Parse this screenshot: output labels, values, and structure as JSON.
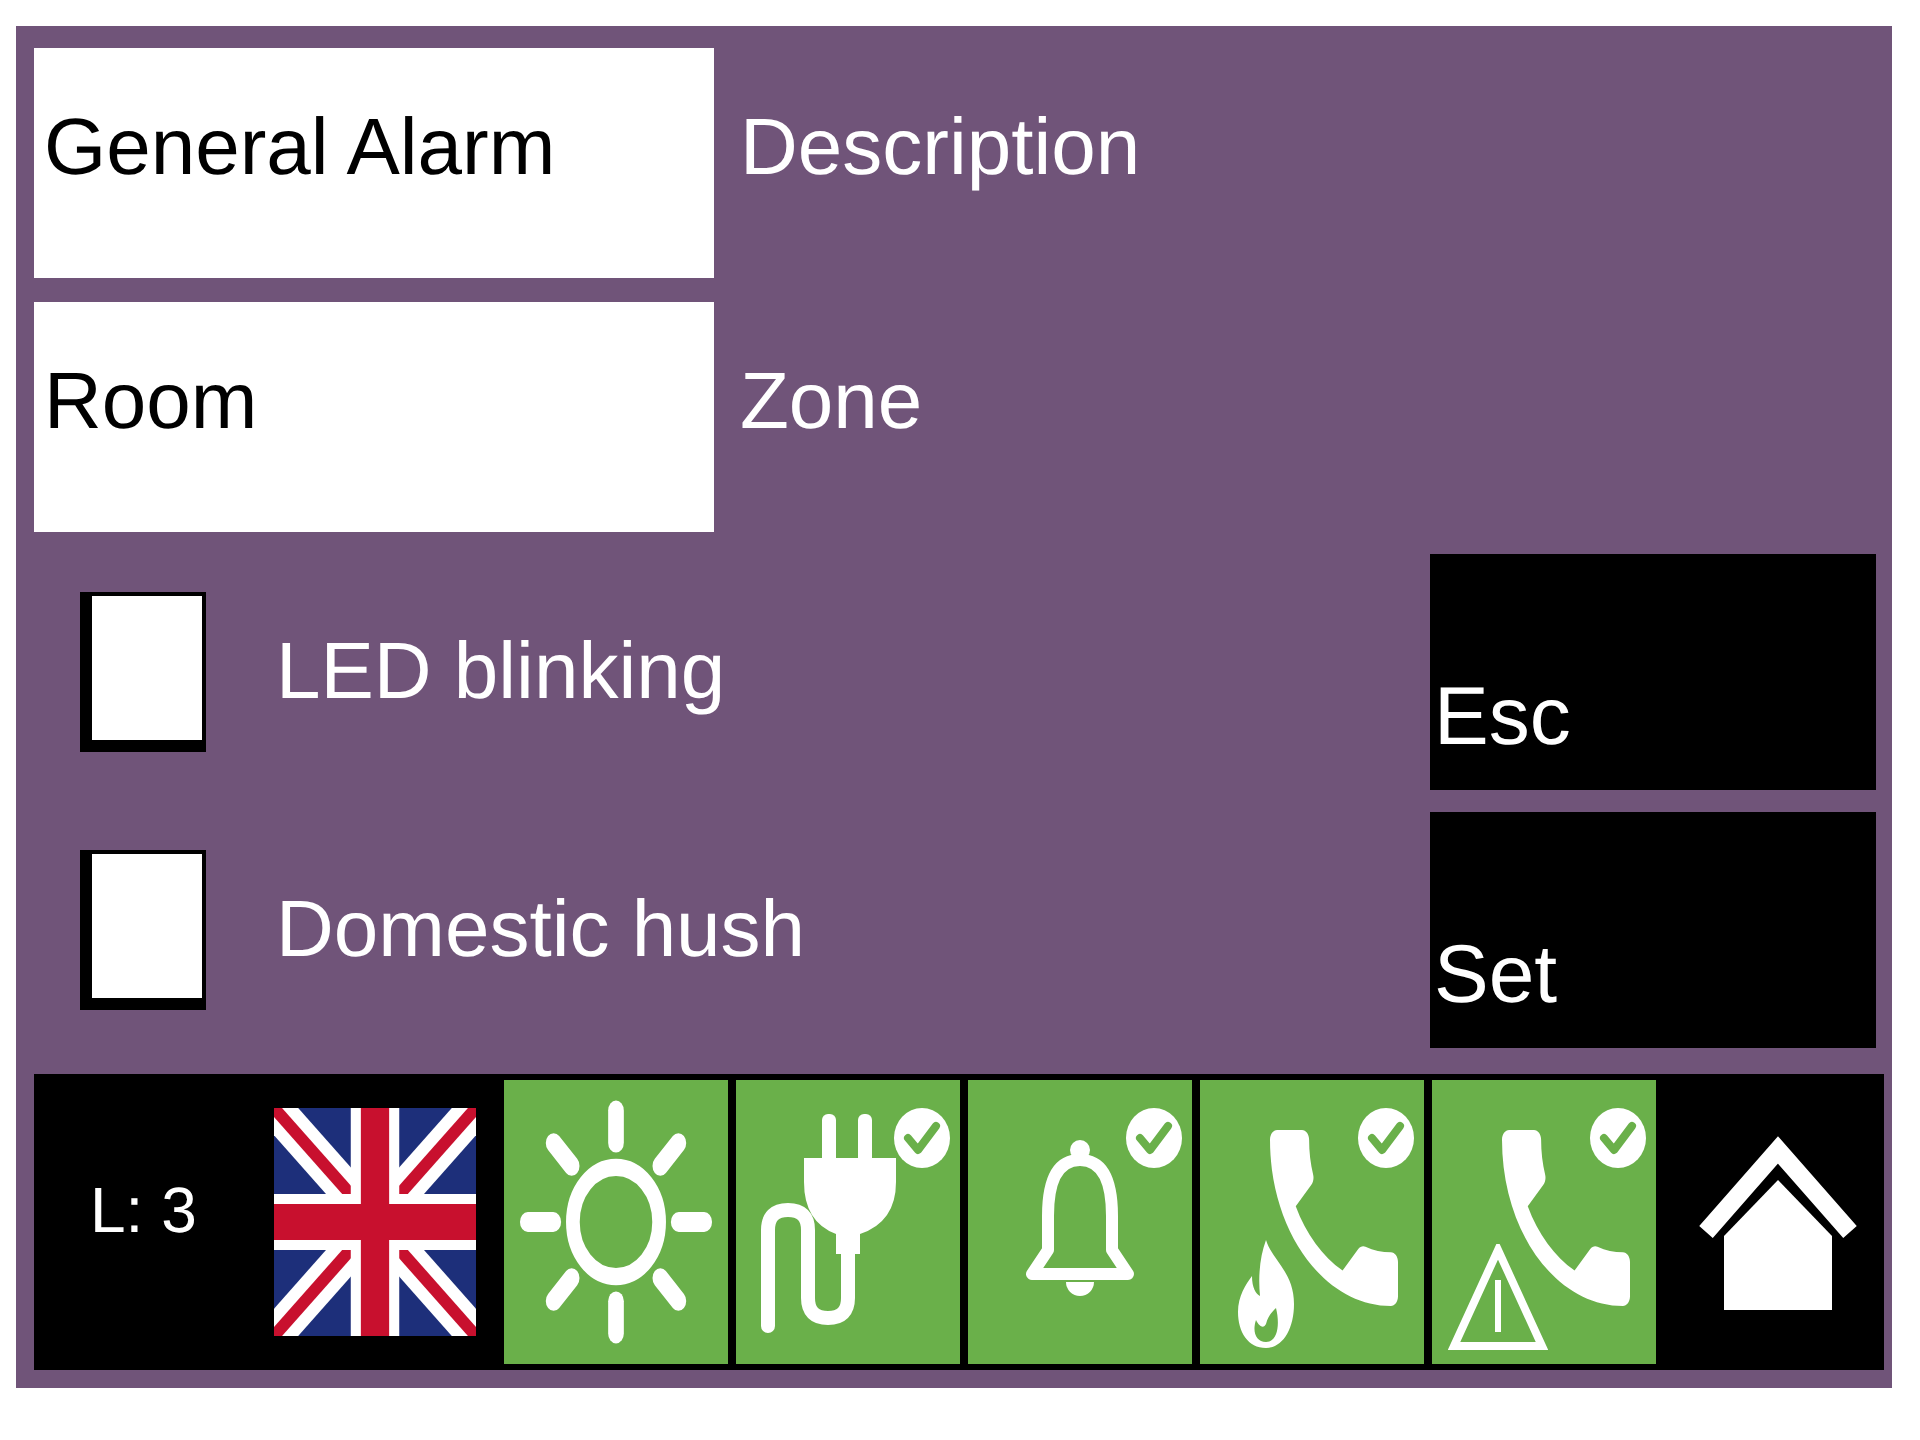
{
  "form": {
    "fields": [
      {
        "value": "General Alarm",
        "label": "Description"
      },
      {
        "value": "Room",
        "label": "Zone"
      }
    ]
  },
  "options": [
    {
      "label": "LED blinking",
      "checked": false
    },
    {
      "label": "Domestic hush",
      "checked": false
    }
  ],
  "buttons": [
    {
      "label": "Esc"
    },
    {
      "label": "Set"
    }
  ],
  "status_bar": {
    "level_label": "L: 3",
    "tiles": [
      {
        "kind": "brightness",
        "confirmed": false
      },
      {
        "kind": "power",
        "confirmed": true
      },
      {
        "kind": "sounder",
        "confirmed": true
      },
      {
        "kind": "fire-call",
        "confirmed": true
      },
      {
        "kind": "fault-call",
        "confirmed": true
      }
    ]
  }
}
